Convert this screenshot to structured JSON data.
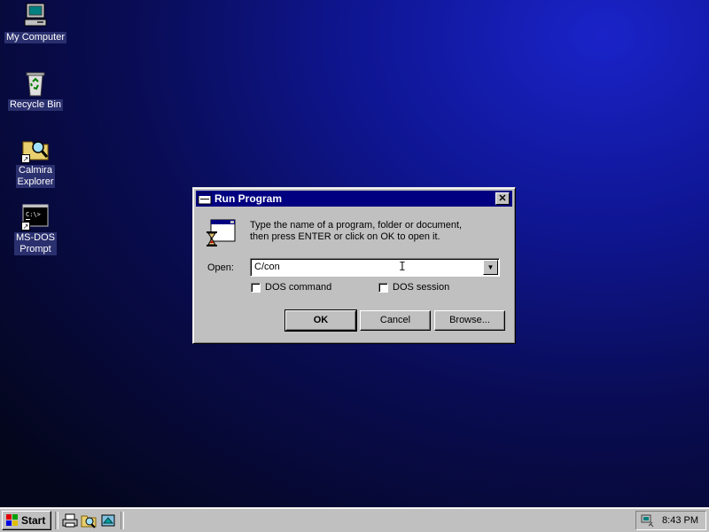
{
  "desktop": {
    "icons": [
      {
        "label": "My Computer"
      },
      {
        "label": "Recycle Bin"
      },
      {
        "label_lines": [
          "Calmira",
          "Explorer"
        ]
      },
      {
        "label_lines": [
          "MS-DOS",
          "Prompt"
        ]
      }
    ],
    "background_colors": [
      "#1a23c8",
      "#090c52",
      "#04061c"
    ]
  },
  "dialog": {
    "title": "Run Program",
    "close_glyph": "✕",
    "description_lines": [
      "Type the name of a program, folder or document,",
      "then press ENTER or click on OK to open it."
    ],
    "open_label": "Open:",
    "open_value": "C/con",
    "options": [
      {
        "label": "DOS command",
        "checked": false
      },
      {
        "label": "DOS session",
        "checked": false
      }
    ],
    "buttons": {
      "ok": "OK",
      "cancel": "Cancel",
      "browse": "Browse..."
    }
  },
  "taskbar": {
    "start_label": "Start",
    "quick_launch_icons": [
      "printer-icon",
      "explorer-icon",
      "settings-icon"
    ],
    "tray_icon": "network-icon",
    "clock": "8:43 PM"
  },
  "colors": {
    "titlebar": "#000080",
    "face": "#c0c0c0"
  }
}
